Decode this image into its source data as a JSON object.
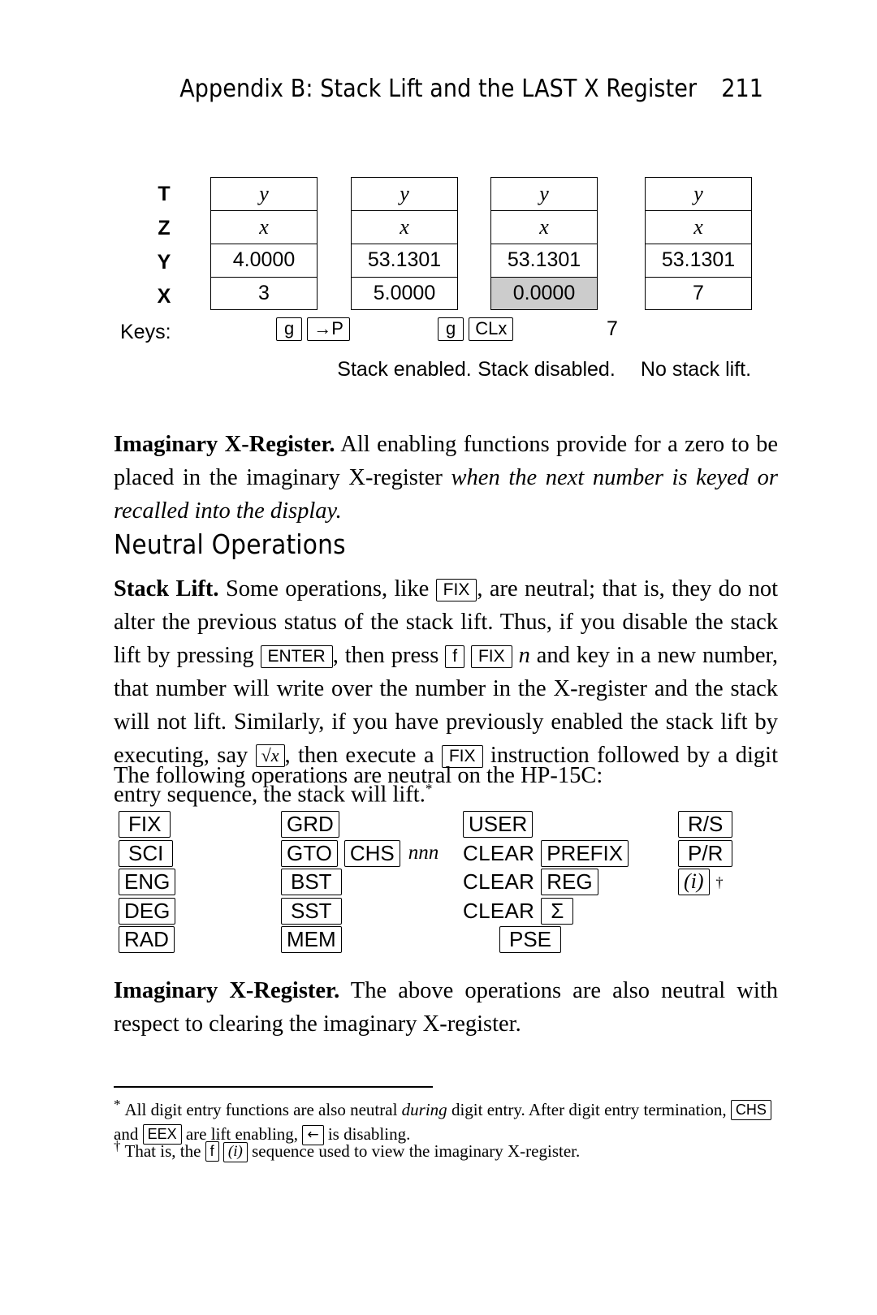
{
  "running_head": {
    "title": "Appendix B: Stack Lift and the LAST X Register",
    "page_number": "211"
  },
  "stack_diagram": {
    "row_labels": [
      "T",
      "Z",
      "Y",
      "X"
    ],
    "keys_label": "Keys:",
    "columns": [
      {
        "cells": [
          "y",
          "x",
          "4.0000",
          "3"
        ],
        "shaded_row": null,
        "keys": [],
        "caption": ""
      },
      {
        "cells": [
          "y",
          "x",
          "53.1301",
          "5.0000"
        ],
        "shaded_row": null,
        "keys": [
          "g",
          "→P"
        ],
        "caption": "Stack enabled."
      },
      {
        "cells": [
          "y",
          "x",
          "53.1301",
          "0.0000"
        ],
        "shaded_row": 3,
        "keys": [
          "g",
          "CLx"
        ],
        "caption": "Stack disabled."
      },
      {
        "cells": [
          "y",
          "x",
          "53.1301",
          "7"
        ],
        "shaded_row": null,
        "keys": [
          "7"
        ],
        "caption": "No stack lift."
      }
    ],
    "shade_color": "#cccccc"
  },
  "paragraph_imaginary_1": {
    "lead": "Imaginary X-Register.",
    "text_normal": " All enabling functions provide for a zero to be placed in the imaginary X-register ",
    "text_italic": "when the next number is keyed or recalled into the display."
  },
  "section_heading": "Neutral Operations",
  "paragraph_stack_lift": {
    "lead": "Stack Lift.",
    "t1": " Some operations, like ",
    "key1": "FIX",
    "t2": ", are neutral; that is, they do not alter the previous status of the stack lift. Thus, if you disable the stack lift by pressing ",
    "key2": "ENTER",
    "t3": ", then press ",
    "key3": "f",
    "key4": "FIX",
    "t4": " n",
    "t5": " and key in a new number, that number will write over the number in the X-register and the stack will not lift. Similarly, if you have previously enabled the stack lift by executing, say ",
    "key5": "√x",
    "t6": ", then execute a ",
    "key6": "FIX",
    "t7": " instruction followed by a digit entry sequence, the stack will lift.",
    "footnote_marker": "*"
  },
  "paragraph_following": "The following operations are neutral on the HP-15C:",
  "neutral_ops": {
    "col0": [
      "FIX",
      "SCI",
      "ENG",
      "DEG",
      "RAD"
    ],
    "col1": [
      "GRD",
      "GTO",
      "BST",
      "SST",
      "MEM"
    ],
    "col1_extra": {
      "row": 1,
      "key": "CHS",
      "suffix": "nnn"
    },
    "col2": [
      {
        "word": "",
        "key": "USER"
      },
      {
        "word": "CLEAR",
        "key": "PREFIX"
      },
      {
        "word": "CLEAR",
        "key": "REG"
      },
      {
        "word": "CLEAR",
        "key": "Σ"
      },
      {
        "word": "",
        "key": "PSE",
        "indent": true
      }
    ],
    "col3": [
      {
        "key": "R/S",
        "sup": ""
      },
      {
        "key": "P/R",
        "sup": ""
      },
      {
        "key": "(i)",
        "sup": "†"
      }
    ]
  },
  "paragraph_imaginary_2": {
    "lead": "Imaginary X-Register.",
    "text": " The above operations are also neutral with respect to clearing the imaginary X-register."
  },
  "footnotes": [
    {
      "marker": "*",
      "t1": "All digit entry functions are also neutral ",
      "i1": "during",
      "t2": " digit entry. After digit entry termination, ",
      "k1": "CHS",
      "t3": " and ",
      "k2": "EEX",
      "t4": " are lift enabling, ",
      "k3": "←",
      "t5": " is disabling."
    },
    {
      "marker": "†",
      "t1": "That is, the ",
      "k1": "f",
      "k2": "(i)",
      "t2": " sequence used to view the imaginary X-register."
    }
  ]
}
